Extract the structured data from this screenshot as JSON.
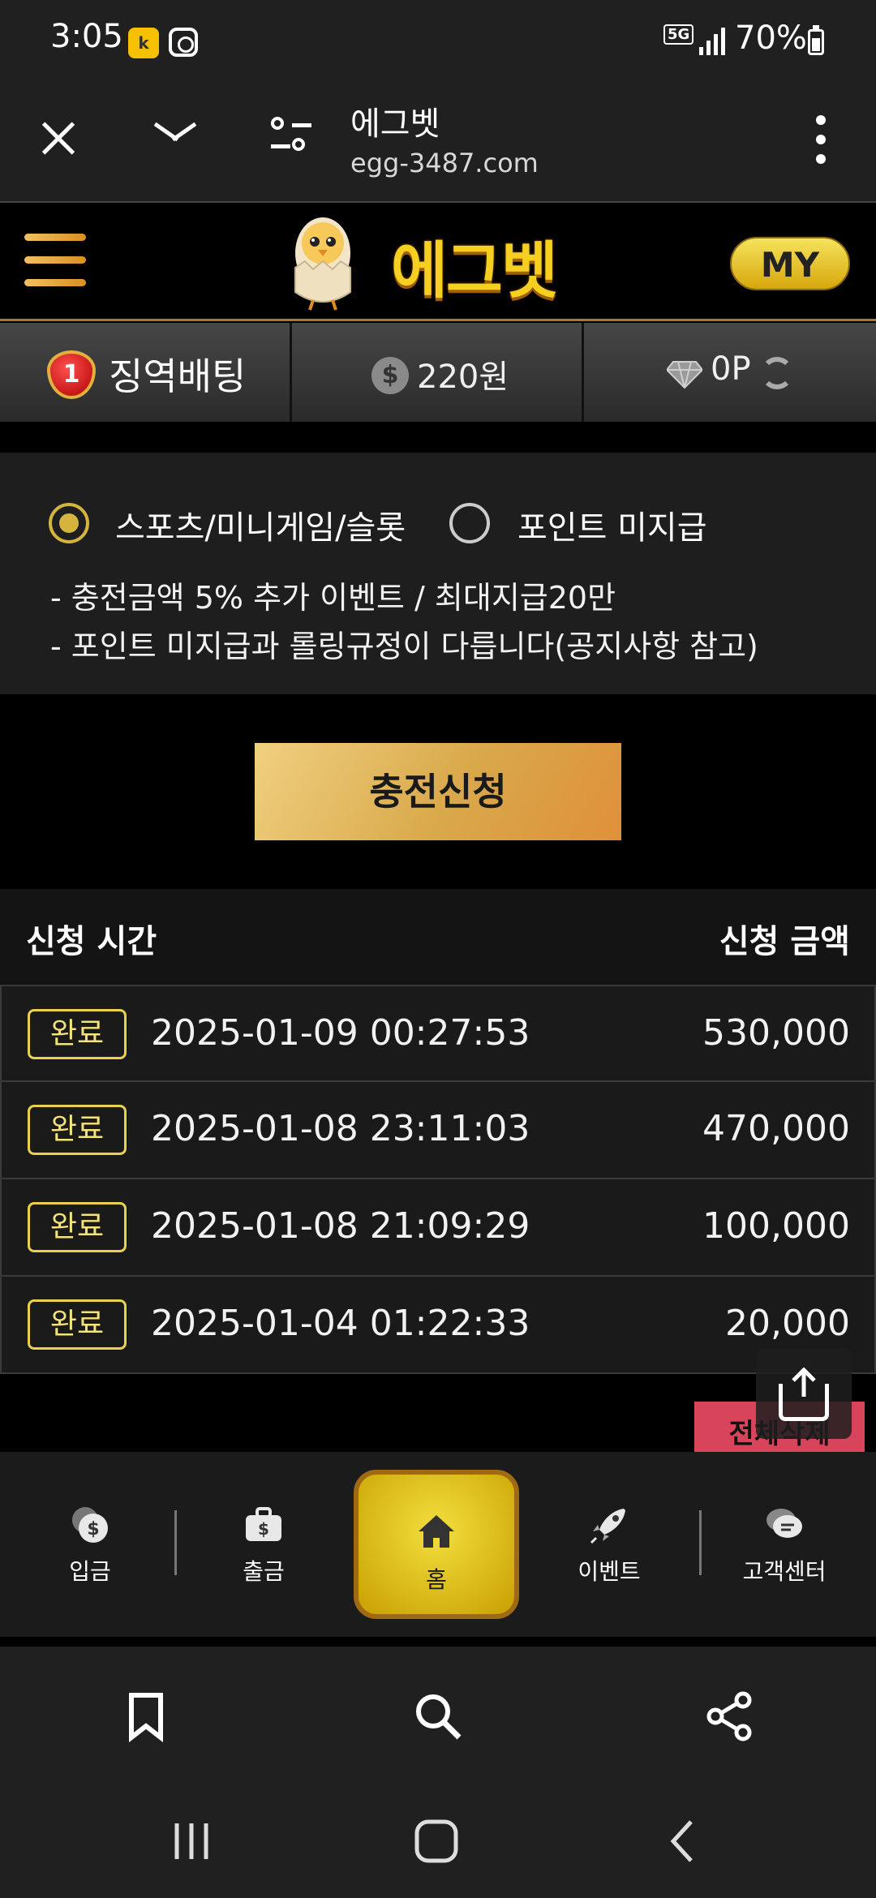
{
  "status_bar": {
    "time": "3:05",
    "network": "5G",
    "battery": "70%"
  },
  "browser": {
    "title": "에그벳",
    "url": "egg-3487.com"
  },
  "site": {
    "logo_text": "에그벳",
    "my_label": "MY"
  },
  "info": {
    "level": "1",
    "level_label": "징역배팅",
    "money": "220원",
    "points": "0P"
  },
  "options": {
    "radio1": "스포츠/미니게임/슬롯",
    "radio2": "포인트 미지급",
    "note1": "- 충전금액 5% 추가 이벤트 / 최대지급20만",
    "note2": "- 포인트 미지급과 롤링규정이 다릅니다(공지사항 참고)"
  },
  "charge_button": "충전신청",
  "table": {
    "col_time": "신청 시간",
    "col_amount": "신청 금액",
    "rows": [
      {
        "status": "완료",
        "time": "2025-01-09 00:27:53",
        "amount": "530,000"
      },
      {
        "status": "완료",
        "time": "2025-01-08 23:11:03",
        "amount": "470,000"
      },
      {
        "status": "완료",
        "time": "2025-01-08 21:09:29",
        "amount": "100,000"
      },
      {
        "status": "완료",
        "time": "2025-01-04 01:22:33",
        "amount": "20,000"
      }
    ]
  },
  "delete_all": "전체삭제",
  "nav": {
    "deposit": "입금",
    "withdraw": "출금",
    "home": "홈",
    "event": "이벤트",
    "support": "고객센터"
  },
  "colors": {
    "gold": "#d4b43c",
    "accent_yellow": "#f5d020",
    "badge_border": "#e8d24a",
    "delete_red": "#d8445a"
  }
}
